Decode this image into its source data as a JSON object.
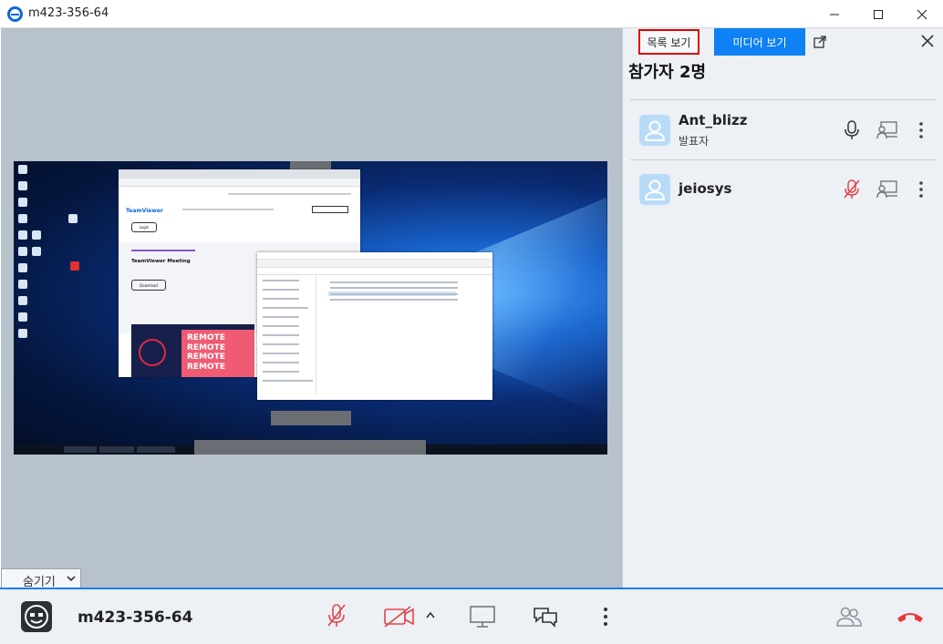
{
  "window": {
    "title": "m423-356-64",
    "controls": [
      "minimize-icon",
      "maximize-icon",
      "close-icon"
    ]
  },
  "remote_screen": {
    "browser_login": "Login",
    "browser_heading": "TeamViewer Meeting",
    "browser_download": "Download",
    "browser_logo": "TeamViewer",
    "promo_text": "REMOTE REMOTE REMOTE REMOTE"
  },
  "hide_bar": {
    "label": "숨기기"
  },
  "panel": {
    "tabs": [
      {
        "label": "목록 보기",
        "active": false,
        "highlighted": true
      },
      {
        "label": "미디어 보기",
        "active": true
      }
    ],
    "participants_title": "참가자 2명",
    "participants": [
      {
        "name": "Ant_blizz",
        "role": "발표자",
        "mic": "on"
      },
      {
        "name": "jeiosys",
        "role": "",
        "mic": "muted"
      }
    ]
  },
  "bottom_bar": {
    "session_id": "m423-356-64",
    "icons": [
      "mic-muted-icon",
      "camera-off-icon",
      "chevron-up-icon",
      "screen-share-icon",
      "chat-icon",
      "more-icon",
      "participants-icon",
      "hang-up-icon"
    ]
  },
  "colors": {
    "accent": "#0e81f5",
    "muted_red": "#e0454a",
    "highlight_border": "#e00000"
  }
}
